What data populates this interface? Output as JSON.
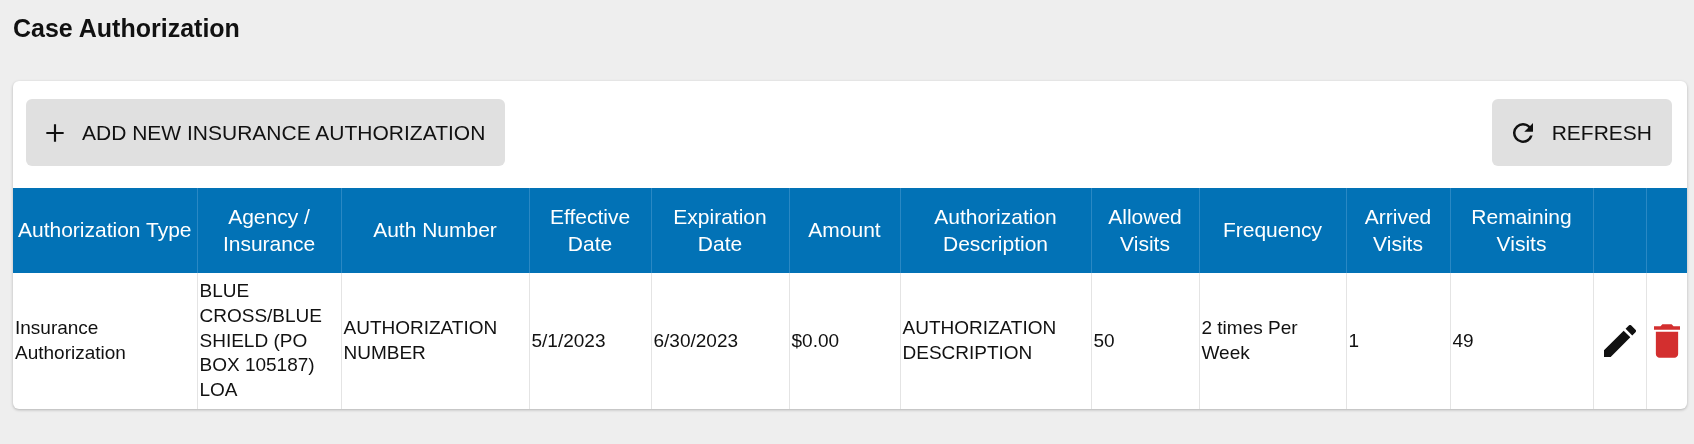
{
  "page_title": "Case Authorization",
  "toolbar": {
    "add_button": "ADD NEW INSURANCE AUTHORIZATION",
    "refresh_button": "REFRESH"
  },
  "table": {
    "columns": [
      "Authorization Type",
      "Agency / Insurance",
      "Auth Number",
      "Effective Date",
      "Expiration Date",
      "Amount",
      "Authorization Description",
      "Allowed Visits",
      "Frequency",
      "Arrived Visits",
      "Remaining Visits"
    ],
    "rows": [
      {
        "cells": [
          "Insurance Authorization",
          "BLUE CROSS/BLUE SHIELD (PO BOX 105187) LOA",
          "AUTHORIZATION NUMBER",
          "5/1/2023",
          "6/30/2023",
          "$0.00",
          "AUTHORIZATION DESCRIPTION",
          "50",
          "2 times Per Week",
          "1",
          "49"
        ]
      }
    ]
  }
}
